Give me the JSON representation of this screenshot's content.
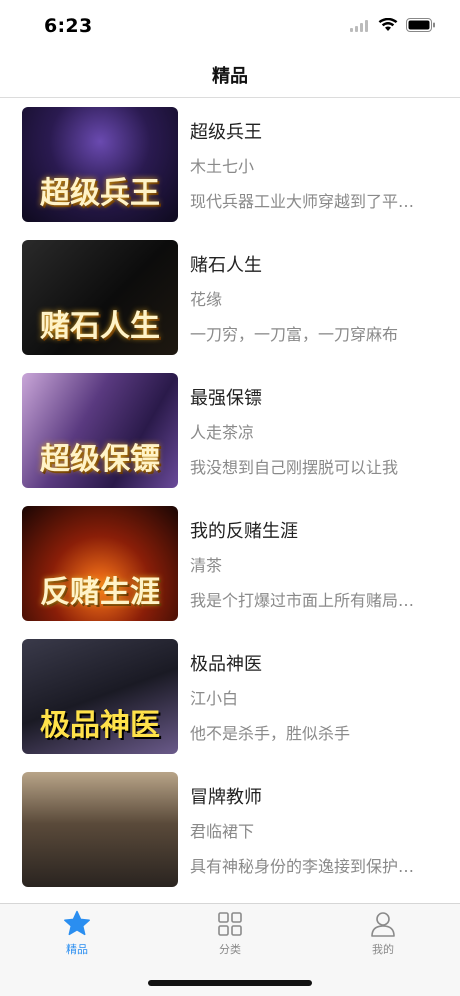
{
  "status_bar": {
    "time": "6:23"
  },
  "nav": {
    "title": "精品"
  },
  "books": [
    {
      "title": "超级兵王",
      "author": "木土七小",
      "desc": "现代兵器工业大师穿越到了平行世界",
      "cover_text": "超级兵王",
      "cover_bg": "#1a1233"
    },
    {
      "title": "赌石人生",
      "author": "花缘",
      "desc": "一刀穷，一刀富，一刀穿麻布",
      "cover_text": "赌石人生",
      "cover_bg": "#141414"
    },
    {
      "title": "最强保镖",
      "author": "人走茶凉",
      "desc": "我没想到自己刚摆脱可以让我",
      "cover_text": "超级保镖",
      "cover_bg": "#4a2a6a"
    },
    {
      "title": "我的反赌生涯",
      "author": "清茶",
      "desc": "我是个打爆过市面上所有赌局的人",
      "cover_text": "反赌生涯",
      "cover_bg": "#3a0c06"
    },
    {
      "title": "极品神医",
      "author": "江小白",
      "desc": "他不是杀手，胜似杀手",
      "cover_text": "极品神医",
      "cover_bg": "#1c1c2a"
    },
    {
      "title": "冒牌教师",
      "author": "君临裙下",
      "desc": "具有神秘身份的李逸接到保护任务",
      "cover_text": "",
      "cover_bg": "#8a7a66"
    }
  ],
  "tabs": [
    {
      "label": "精品",
      "icon": "star-icon",
      "active": true
    },
    {
      "label": "分类",
      "icon": "grid-icon",
      "active": false
    },
    {
      "label": "我的",
      "icon": "user-icon",
      "active": false
    }
  ],
  "colors": {
    "accent": "#2a8ef0",
    "secondary_text": "#8a8a8a",
    "tab_bar_bg": "#f7f7f7"
  }
}
